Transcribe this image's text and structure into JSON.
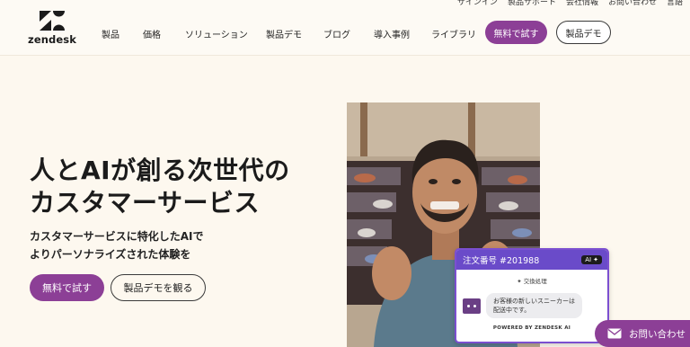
{
  "utility_nav": [
    "サインイン",
    "製品サポート",
    "会社情報",
    "お問い合わせ",
    "言語"
  ],
  "logo": {
    "text": "zendesk"
  },
  "nav": [
    "製品",
    "価格",
    "ソリューション",
    "製品デモ",
    "ブログ",
    "導入事例",
    "ライブラリ"
  ],
  "header_buttons": {
    "trial": "無料で試す",
    "demo": "製品デモ"
  },
  "hero": {
    "title_line1": "人とAIが創る次世代の",
    "title_line2": "カスタマーサービス",
    "sub_line1": "カスタマーサービスに特化したAIで",
    "sub_line2": "よりパーソナライズされた体験を",
    "trial_label": "無料で試す",
    "demo_label": "製品デモを観る"
  },
  "ai_card": {
    "order": "注文番号 #201988",
    "badge": "AI",
    "process": "交換処理",
    "message_line1": "お客様の新しいスニーカーは",
    "message_line2": "配送中です。",
    "footer": "POWERED BY ZENDESK AI"
  },
  "contact_tab": {
    "label": "お問い合わせ"
  },
  "colors": {
    "brand": "#8c3f96",
    "ai_header": "#6a4bc9",
    "background": "#fdf8ef"
  }
}
